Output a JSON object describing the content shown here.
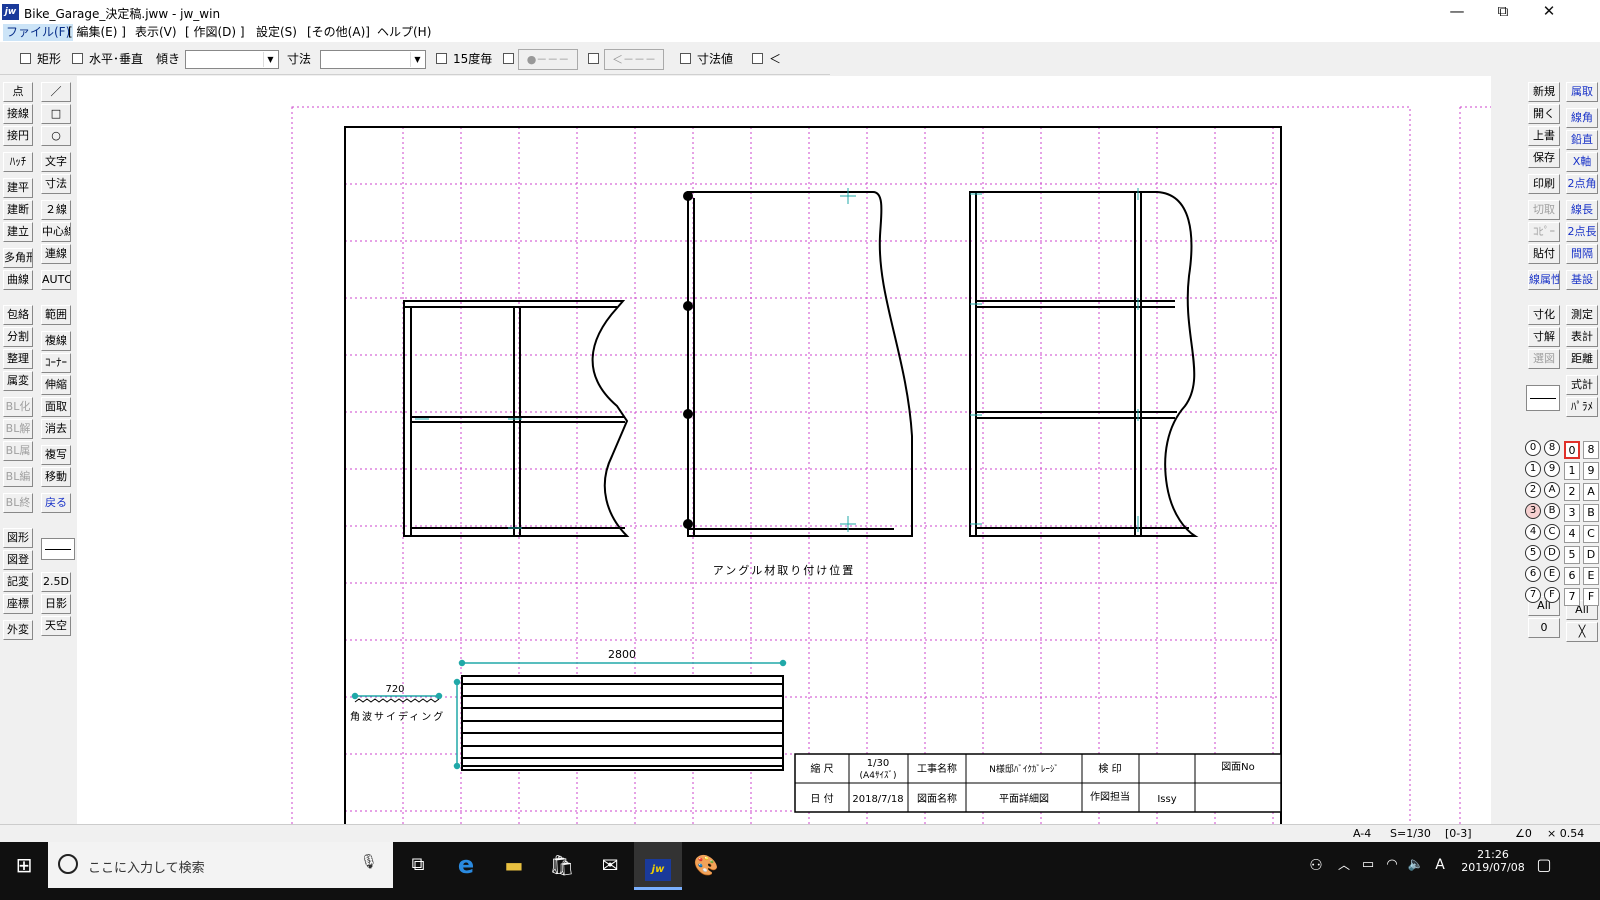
{
  "window": {
    "title": "Bike_Garage_決定稿.jww - jw_win",
    "app_icon": "jw",
    "minimize": "—",
    "maximize": "⧉",
    "close": "✕"
  },
  "menu": [
    "ファイル(F)",
    "[ 編集(E) ]",
    "表示(V)",
    "[ 作図(D) ]",
    "設定(S)",
    "[その他(A)]",
    "ヘルプ(H)"
  ],
  "toolbar": {
    "rect": "矩形",
    "hv": "水平･垂直",
    "slope": "傾き",
    "dim": "寸法",
    "deg15": "15度毎",
    "dim_value": "寸法値",
    "btn1": "●－－－",
    "btn2": "＜－－－",
    "last": "＜"
  },
  "left_tools_a": [
    "点",
    "接線",
    "接円",
    "ﾊｯﾁ",
    "建平",
    "建断",
    "建立",
    "多角形",
    "曲線",
    "包絡",
    "分割",
    "整理",
    "属変",
    "BL化",
    "BL解",
    "BL属",
    "BL編",
    "BL終",
    "図形",
    "図登",
    "記変",
    "座標",
    "外変"
  ],
  "left_tools_b": [
    "／",
    "□",
    "○",
    "文字",
    "寸法",
    "２線",
    "中心線",
    "連線",
    "AUTO",
    "範囲",
    "複線",
    "ｺｰﾅｰ",
    "伸縮",
    "面取",
    "消去",
    "複写",
    "移動",
    "戻る",
    "2.5D",
    "日影",
    "天空"
  ],
  "right_tools_a": [
    "新規",
    "開く",
    "上書",
    "保存",
    "印刷",
    "切取",
    "ｺﾋﾟｰ",
    "貼付",
    "線属性",
    "寸化",
    "寸解",
    "選図",
    "All",
    "0"
  ],
  "right_tools_b": [
    "属取",
    "線角",
    "鉛直",
    "X軸",
    "2点角",
    "線長",
    "2点長",
    "間隔",
    "基設",
    "測定",
    "表計",
    "距離",
    "式計",
    "ﾊﾟﾗﾒ",
    "All",
    "╳"
  ],
  "layer_groups": [
    "0",
    "1",
    "2",
    "3",
    "4",
    "5",
    "6",
    "7",
    "8",
    "9",
    "A",
    "B",
    "C",
    "D",
    "E",
    "F"
  ],
  "layers": [
    "0",
    "1",
    "2",
    "3",
    "4",
    "5",
    "6",
    "7",
    "8",
    "9",
    "A",
    "B",
    "C",
    "D",
    "E",
    "F"
  ],
  "drawing": {
    "caption": "アングル材取り付け位置",
    "dim_main": "2800",
    "dim_small": "720",
    "siding_label": "角波サイディング",
    "title_block": {
      "scale_label": "縮 尺",
      "scale_value": "1/30",
      "scale_sub": "(A4ｻｲｽﾞ)",
      "project_label": "工事名称",
      "project_value": "N様邸ﾊﾞｲｸｶﾞﾚｰｼﾞ",
      "stamp_label": "検 印",
      "drawing_no_label": "図面No",
      "date_label": "日 付",
      "date_value": "2018/7/18",
      "drawing_name_label": "図面名称",
      "drawing_name_value": "平面詳細図",
      "drafter_label": "作図担当",
      "drafter_value": "Issy"
    }
  },
  "status": [
    "A-4",
    "S=1/30",
    "[0-3]",
    "∠0",
    "× 0.54"
  ],
  "taskbar": {
    "search_placeholder": "ここに入力して検索",
    "time": "21:26",
    "date": "2019/07/08",
    "ime": "A"
  },
  "colors": {
    "grid": "#cc44cc",
    "accent": "#20a8a8",
    "active_menu": "#cce4f7",
    "taskbar": "#101010"
  }
}
